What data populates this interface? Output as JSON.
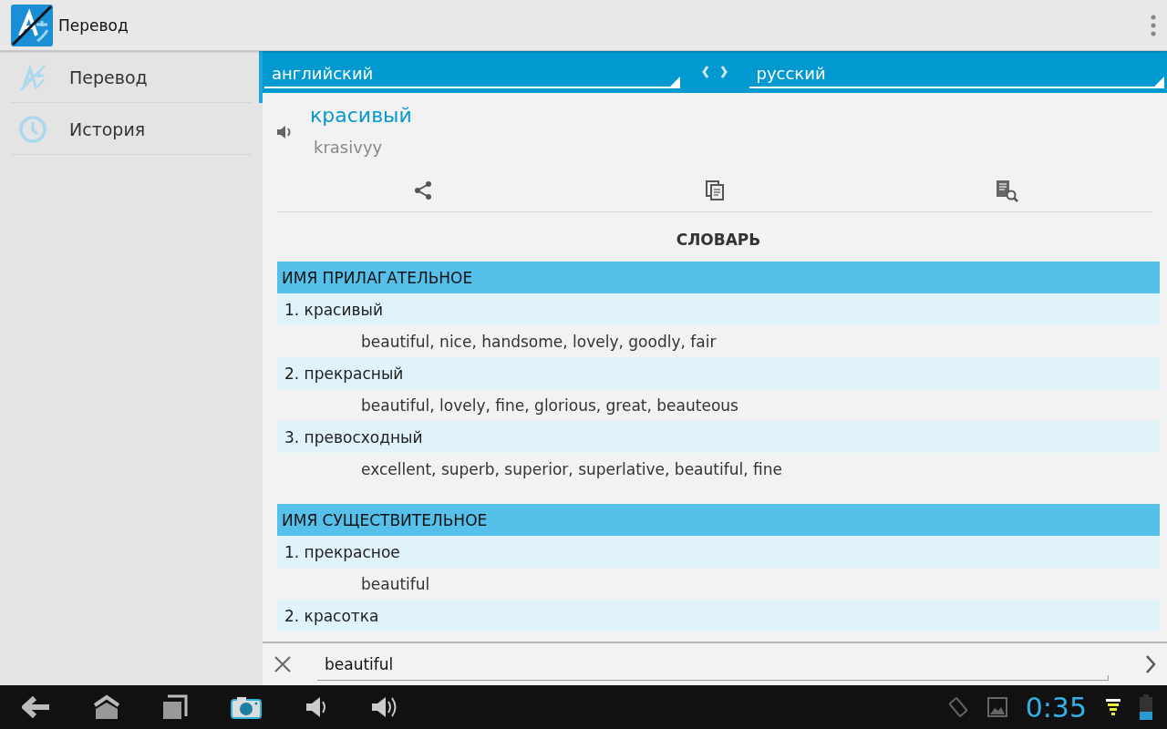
{
  "action_bar": {
    "title": "Перевод"
  },
  "sidebar": {
    "items": [
      {
        "label": "Перевод",
        "kind": "translate",
        "selected": true
      },
      {
        "label": "История",
        "kind": "history",
        "selected": false
      }
    ]
  },
  "languages": {
    "source": "английский",
    "target": "русский"
  },
  "result": {
    "word": "красивый",
    "transliteration": "krasivyy"
  },
  "dictionary": {
    "title": "СЛОВАРЬ",
    "sections": [
      {
        "part_of_speech": "ИМЯ ПРИЛАГАТЕЛЬНОЕ",
        "entries": [
          {
            "word": "1. красивый",
            "translations": "beautiful, nice, handsome, lovely, goodly, fair"
          },
          {
            "word": "2. прекрасный",
            "translations": "beautiful, lovely, fine, glorious, great, beauteous"
          },
          {
            "word": "3. превосходный",
            "translations": "excellent, superb, superior, superlative, beautiful, fine"
          }
        ]
      },
      {
        "part_of_speech": "ИМЯ СУЩЕСТВИТЕЛЬНОЕ",
        "entries": [
          {
            "word": "1. прекрасное",
            "translations": "beautiful"
          },
          {
            "word": "2. красотка"
          }
        ]
      }
    ]
  },
  "input": {
    "value": "beautiful"
  },
  "status": {
    "time": "0:35"
  }
}
